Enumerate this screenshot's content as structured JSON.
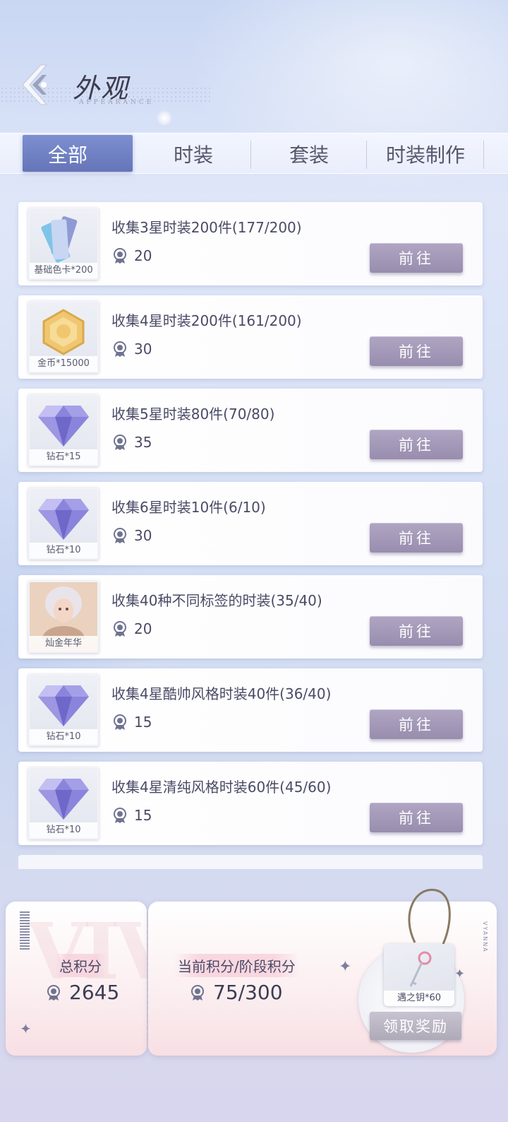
{
  "header": {
    "title": "外观",
    "subtitle": "APPEARANCE"
  },
  "tabs": [
    {
      "label": "全部",
      "active": true
    },
    {
      "label": "时装",
      "active": false
    },
    {
      "label": "套装",
      "active": false
    },
    {
      "label": "时装制作",
      "active": false
    }
  ],
  "tasks": [
    {
      "title": "收集3星时装200件(177/200)",
      "points": "20",
      "reward_label": "基础色卡*200",
      "reward_icon": "color-card-icon",
      "button": "前往"
    },
    {
      "title": "收集4星时装200件(161/200)",
      "points": "30",
      "reward_label": "金币*15000",
      "reward_icon": "gold-coin-icon",
      "button": "前往"
    },
    {
      "title": "收集5星时装80件(70/80)",
      "points": "35",
      "reward_label": "钻石*15",
      "reward_icon": "diamond-icon",
      "button": "前往"
    },
    {
      "title": "收集6星时装10件(6/10)",
      "points": "30",
      "reward_label": "钻石*10",
      "reward_icon": "diamond-icon",
      "button": "前往"
    },
    {
      "title": "收集40种不同标签的时装(35/40)",
      "points": "20",
      "reward_label": "灿金年华",
      "reward_icon": "portrait-icon",
      "button": "前往"
    },
    {
      "title": "收集4星酷帅风格时装40件(36/40)",
      "points": "15",
      "reward_label": "钻石*10",
      "reward_icon": "diamond-icon",
      "button": "前往"
    },
    {
      "title": "收集4星清纯风格时装60件(45/60)",
      "points": "15",
      "reward_label": "钻石*10",
      "reward_icon": "diamond-icon",
      "button": "前往"
    }
  ],
  "footer": {
    "total_label": "总积分",
    "total_value": "2645",
    "current_label": "当前积分/阶段积分",
    "current_value": "75/300",
    "reward_label": "遇之钥*60",
    "claim_button": "领取奖励",
    "watermark": "VIVANNA",
    "side_text": "VYANNA"
  },
  "colors": {
    "active_tab": "#6f80c3",
    "go_button": "#a398b8",
    "claim_button": "#b8b4c2"
  }
}
